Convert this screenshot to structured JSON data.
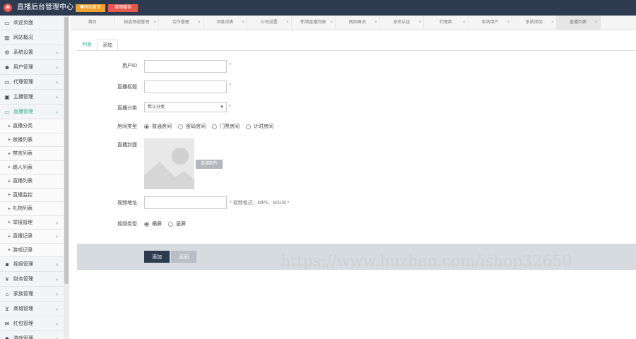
{
  "header": {
    "logo_glyph": "◉",
    "title": "直播后台管理中心",
    "btn_home": "◆网站首页",
    "btn_cache": "清理缓存",
    "bg_color": "#2c3b4f"
  },
  "sidebar": {
    "items": [
      {
        "label": "欢迎页面",
        "icon": "monitor-icon",
        "glyph": "▭",
        "chevron": false
      },
      {
        "label": "网站概况",
        "icon": "chart-icon",
        "glyph": "▥",
        "chevron": false
      },
      {
        "label": "系统设置",
        "icon": "gears-icon",
        "glyph": "⚙",
        "chevron": true
      },
      {
        "label": "用户管理",
        "icon": "users-icon",
        "glyph": "☻",
        "chevron": true
      },
      {
        "label": "代理管理",
        "icon": "monitor-icon",
        "glyph": "▭",
        "chevron": true
      },
      {
        "label": "主播管理",
        "icon": "id-card-icon",
        "glyph": "▣",
        "chevron": true
      },
      {
        "label": "直播管理",
        "icon": "monitor-icon",
        "glyph": "▭",
        "chevron": true,
        "active": true
      }
    ],
    "sub_items": [
      "直播分类",
      "禁播列表",
      "禁言列表",
      "踢人列表",
      "直播列表",
      "直播监控",
      "礼物列表"
    ],
    "lower_items": [
      {
        "label": "举报管理",
        "type": "sub-chevron"
      },
      {
        "label": "直播记录",
        "type": "sub-chevron"
      },
      {
        "label": "游戏记录",
        "type": "sub"
      }
    ],
    "bottom_items": [
      {
        "label": "视频管理",
        "icon": "video-icon",
        "glyph": "■",
        "chevron": true
      },
      {
        "label": "财务管理",
        "icon": "yen-icon",
        "glyph": "¥",
        "chevron": true
      },
      {
        "label": "家族管理",
        "icon": "bank-icon",
        "glyph": "⌂",
        "chevron": true
      },
      {
        "label": "商城管理",
        "icon": "cart-icon",
        "glyph": "⊻",
        "chevron": true
      },
      {
        "label": "红包管理",
        "icon": "envelope-icon",
        "glyph": "✉",
        "chevron": true
      },
      {
        "label": "游戏管理",
        "icon": "gamepad-icon",
        "glyph": "◆",
        "chevron": true
      }
    ]
  },
  "tabs": [
    "首页",
    "知道频道管理",
    "合作管理",
    "消息列表",
    "公司设置",
    "新增直播列表",
    "网站概况",
    "身份认证",
    "代理商",
    "本站用户",
    "系统添加",
    "直播列表"
  ],
  "subtabs": {
    "list": "列表",
    "add": "添加"
  },
  "form": {
    "user_id_label": "用户ID",
    "title_label": "直播标题",
    "category_label": "直播分类",
    "category_value": "默认分类",
    "room_type_label": "房间类型",
    "room_types": [
      "普通房间",
      "密码房间",
      "门票房间",
      "计时房间"
    ],
    "cover_label": "直播封面",
    "choose_image": "选择图片",
    "video_url_label": "视频地址",
    "video_hint": "* 视频格式：MP4、M3U8 *",
    "video_type_label": "视频类型",
    "video_types": [
      "横屏",
      "竖屏"
    ],
    "required": "*"
  },
  "actions": {
    "add": "添加",
    "back": "返回"
  },
  "watermark": "https://www.huzhan.com/ishop32650",
  "colors": {
    "accent": "#3ab393",
    "dark": "#2c3b4f",
    "orange": "#f0a22e",
    "red": "#e65a4e"
  }
}
